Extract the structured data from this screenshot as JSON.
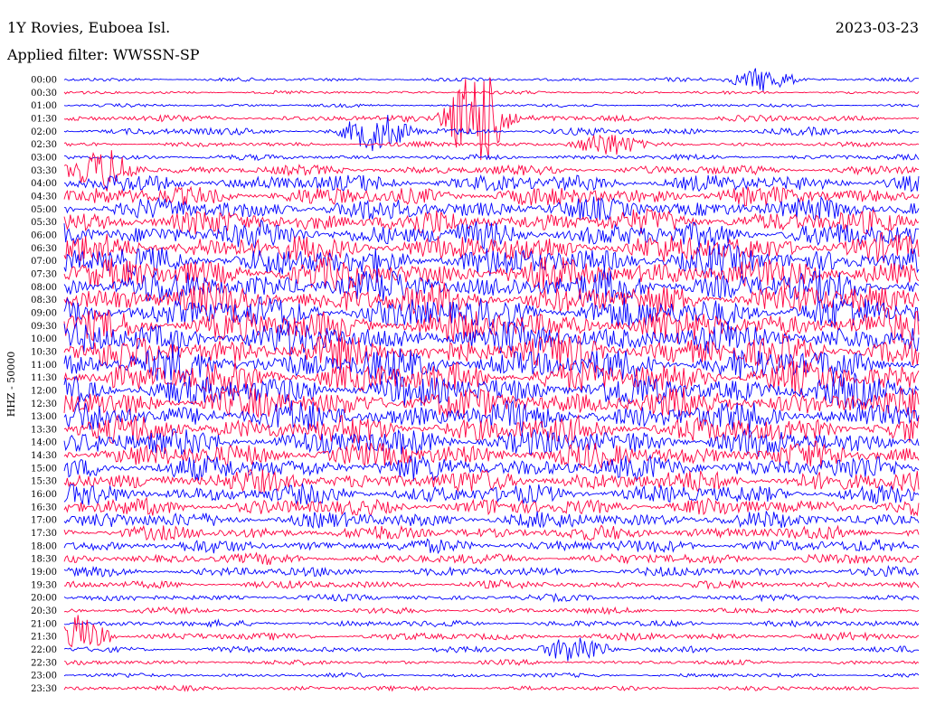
{
  "header": {
    "station": "1Y Rovies, Euboea Isl.",
    "date": "2023-03-23",
    "filter": "Applied filter: WWSSN-SP"
  },
  "chart_data": {
    "type": "line",
    "title": "1Y Rovies, Euboea Isl.",
    "subtitle": "Applied filter: WWSSN-SP",
    "date": "2023-03-23",
    "ylabel": "HHZ - 50000",
    "trace_labels": [
      "00:00",
      "00:30",
      "01:00",
      "01:30",
      "02:00",
      "02:30",
      "03:00",
      "03:30",
      "04:00",
      "04:30",
      "05:00",
      "05:30",
      "06:00",
      "06:30",
      "07:00",
      "07:30",
      "08:00",
      "08:30",
      "09:00",
      "09:30",
      "10:00",
      "10:30",
      "11:00",
      "11:30",
      "12:00",
      "12:30",
      "13:00",
      "13:30",
      "14:00",
      "14:30",
      "15:00",
      "15:30",
      "16:00",
      "16:30",
      "17:00",
      "17:30",
      "18:00",
      "18:30",
      "19:00",
      "19:30",
      "20:00",
      "20:30",
      "21:00",
      "21:30",
      "22:00",
      "22:30",
      "23:00",
      "23:30"
    ],
    "colors": [
      "#0000ff",
      "#ff0040"
    ],
    "relative_amplitude": [
      0.35,
      0.3,
      0.3,
      0.6,
      0.7,
      0.45,
      0.5,
      0.9,
      1.6,
      1.8,
      2.0,
      2.2,
      2.4,
      2.6,
      2.8,
      2.9,
      3.0,
      3.0,
      3.0,
      3.0,
      3.0,
      3.0,
      3.0,
      3.0,
      2.9,
      2.8,
      2.7,
      2.6,
      2.5,
      2.3,
      2.2,
      2.0,
      1.8,
      1.6,
      1.5,
      1.3,
      1.2,
      1.0,
      0.9,
      0.75,
      0.6,
      0.55,
      0.6,
      0.7,
      0.55,
      0.45,
      0.4,
      0.45
    ],
    "events": [
      {
        "trace": "01:30",
        "minute": 14.5,
        "strength": 9
      },
      {
        "trace": "02:00",
        "minute": 11,
        "strength": 3
      },
      {
        "trace": "03:30",
        "minute": 1.5,
        "strength": 3
      },
      {
        "trace": "02:30",
        "minute": 19,
        "strength": 2
      },
      {
        "trace": "00:00",
        "minute": 24.5,
        "strength": 2
      },
      {
        "trace": "22:00",
        "minute": 18,
        "strength": 2.5
      },
      {
        "trace": "21:30",
        "minute": 0.5,
        "strength": 3
      }
    ]
  }
}
